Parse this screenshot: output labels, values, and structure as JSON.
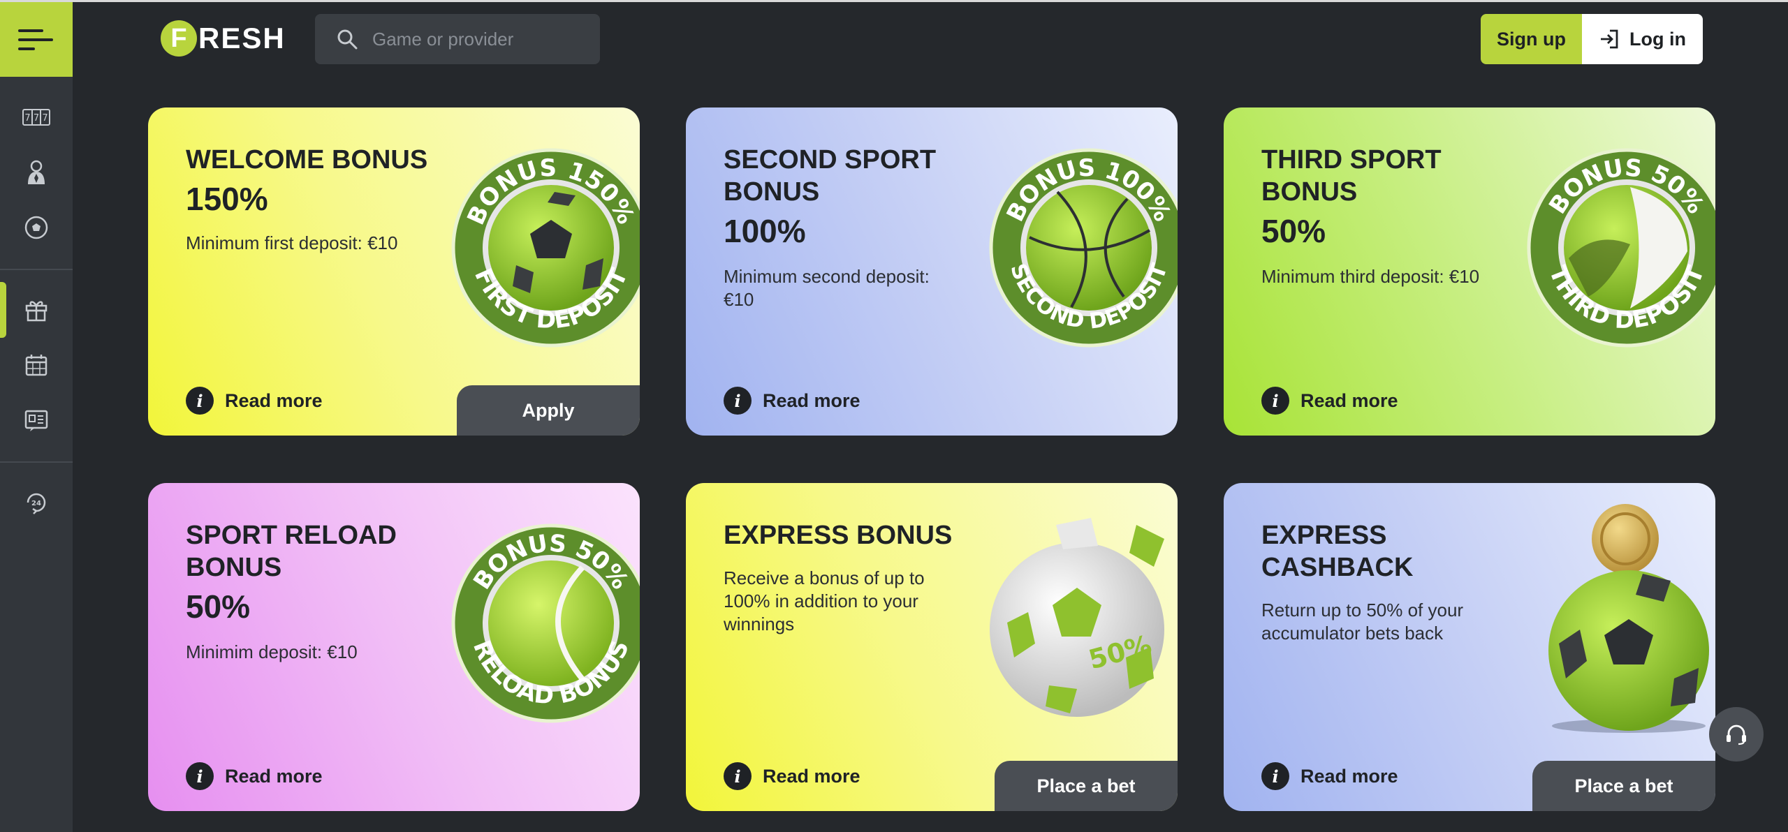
{
  "header": {
    "logo_letter": "F",
    "logo_rest": "RESH",
    "search_placeholder": "Game or provider",
    "signup_label": "Sign up",
    "login_label": "Log in"
  },
  "sidebar": {
    "items": [
      {
        "name": "slots-icon"
      },
      {
        "name": "live-casino-icon"
      },
      {
        "name": "sport-icon"
      },
      {
        "name": "gift-icon",
        "active": true
      },
      {
        "name": "calendar-icon"
      },
      {
        "name": "news-icon"
      },
      {
        "name": "support-24-icon"
      }
    ]
  },
  "cards": [
    {
      "title": "WELCOME BONUS",
      "pct": "150%",
      "desc": "Minimum first deposit: €10",
      "read": "Read more",
      "action": "Apply",
      "badge_top": "BONUS 150%",
      "badge_bottom": "FIRST DEPOSIT",
      "ball": "soccer"
    },
    {
      "title": "SECOND SPORT BONUS",
      "pct": "100%",
      "desc": "Minimum second deposit: €10",
      "read": "Read more",
      "badge_top": "BONUS 100%",
      "badge_bottom": "SECOND DEPOSIT",
      "ball": "basketball"
    },
    {
      "title": "THIRD SPORT BONUS",
      "pct": "50%",
      "desc": "Minimum third deposit: €10",
      "read": "Read more",
      "badge_top": "BONUS 50%",
      "badge_bottom": "THIRD DEPOSIT",
      "ball": "volleyball"
    },
    {
      "title": "SPORT RELOAD BONUS",
      "pct": "50%",
      "desc": "Minimim deposit: €10",
      "read": "Read more",
      "badge_top": "BONUS 50%",
      "badge_bottom": "RELOAD BONUS",
      "ball": "tennis"
    },
    {
      "title": "EXPRESS BONUS",
      "desc": "Receive a bonus of up to 100% in addition to your winnings",
      "read": "Read more",
      "action": "Place a bet",
      "badge_text": "50%"
    },
    {
      "title": "EXPRESS CASHBACK",
      "desc": "Return up to 50% of your accumulator bets back",
      "read": "Read more",
      "action": "Place a bet"
    }
  ],
  "colors": {
    "accent": "#b8d43d",
    "background": "#25282c",
    "sidebar": "#32363b"
  }
}
